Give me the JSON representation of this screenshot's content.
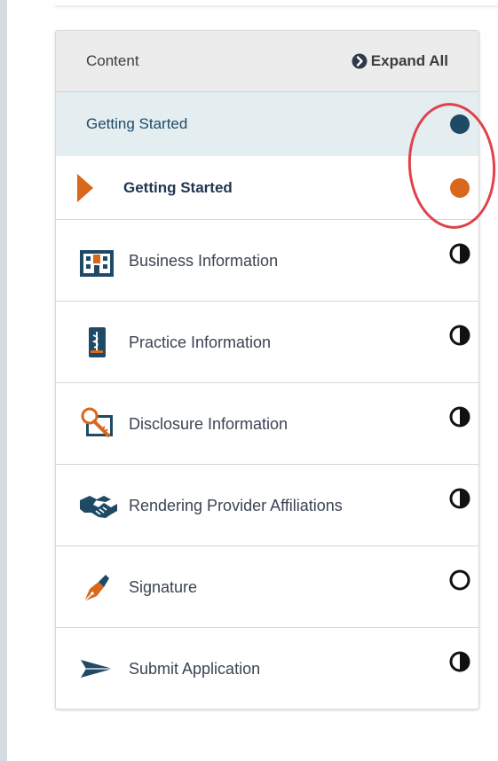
{
  "colors": {
    "primary": "#1f4a66",
    "accent": "#d9671c",
    "highlight_row": "#e4eef1",
    "callout": "#e0414b"
  },
  "panel": {
    "title": "Content",
    "expand_label": "Expand All",
    "expand_icon": "chevron-right-circle-icon"
  },
  "section": {
    "label": "Getting Started",
    "status": "complete"
  },
  "current": {
    "label": "Getting Started",
    "status": "in-progress"
  },
  "items": [
    {
      "label": "Business Information",
      "icon": "building-icon",
      "status": "partial"
    },
    {
      "label": "Practice Information",
      "icon": "medical-document-icon",
      "status": "partial"
    },
    {
      "label": "Disclosure Information",
      "icon": "magnifier-key-icon",
      "status": "partial"
    },
    {
      "label": "Rendering Provider Affiliations",
      "icon": "handshake-icon",
      "status": "partial"
    },
    {
      "label": "Signature",
      "icon": "fountain-pen-icon",
      "status": "not-started"
    },
    {
      "label": "Submit Application",
      "icon": "paper-plane-icon",
      "status": "partial"
    }
  ]
}
